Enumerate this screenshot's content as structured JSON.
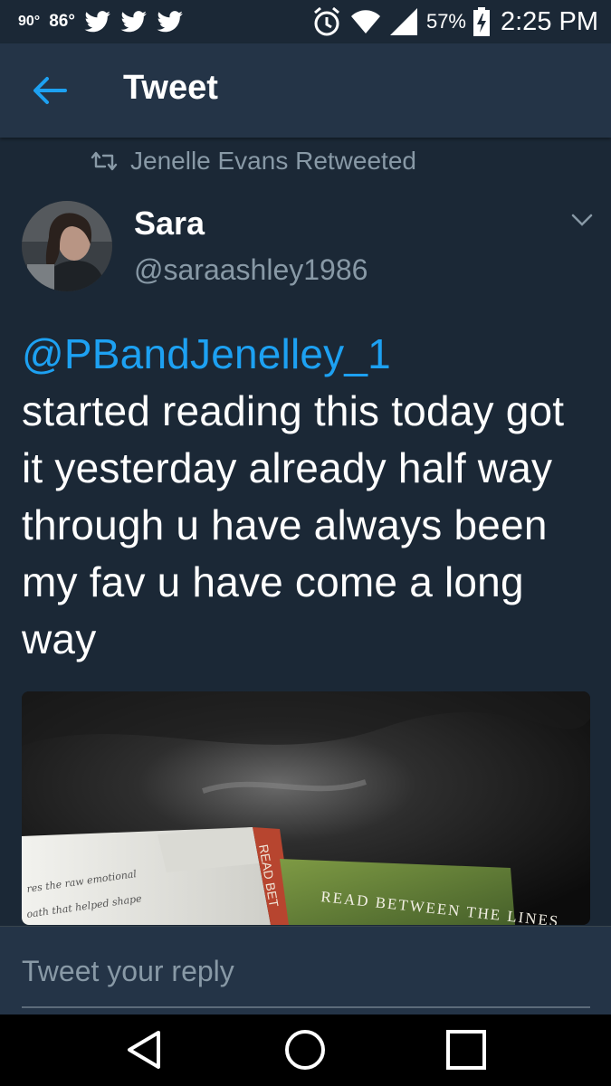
{
  "status_bar": {
    "temp1": "90°",
    "temp2": "86°",
    "notification_icons": [
      "twitter-bird-icon",
      "twitter-bird-icon",
      "twitter-bird-icon"
    ],
    "battery": "57%",
    "time": "2:25 PM"
  },
  "app_bar": {
    "title": "Tweet"
  },
  "tweet": {
    "retweeted_by": "Jenelle Evans Retweeted",
    "author_name": "Sara",
    "author_handle": "@saraashley1986",
    "mention": "@PBandJenelley_1",
    "body": "started reading this today got it yesterday already half way through u have always been my fav u have come a long way",
    "media": {
      "book_spine_text": "READ BET",
      "book_cover_text": "READ BETWEEN THE LINES",
      "page_text_1": "res the raw emotional",
      "page_text_2": "oath that helped shape"
    }
  },
  "reply": {
    "placeholder": "Tweet your reply"
  },
  "colors": {
    "background": "#1b2836",
    "app_bar": "#243447",
    "accent": "#1da1f2",
    "secondary_text": "#8899a6"
  }
}
